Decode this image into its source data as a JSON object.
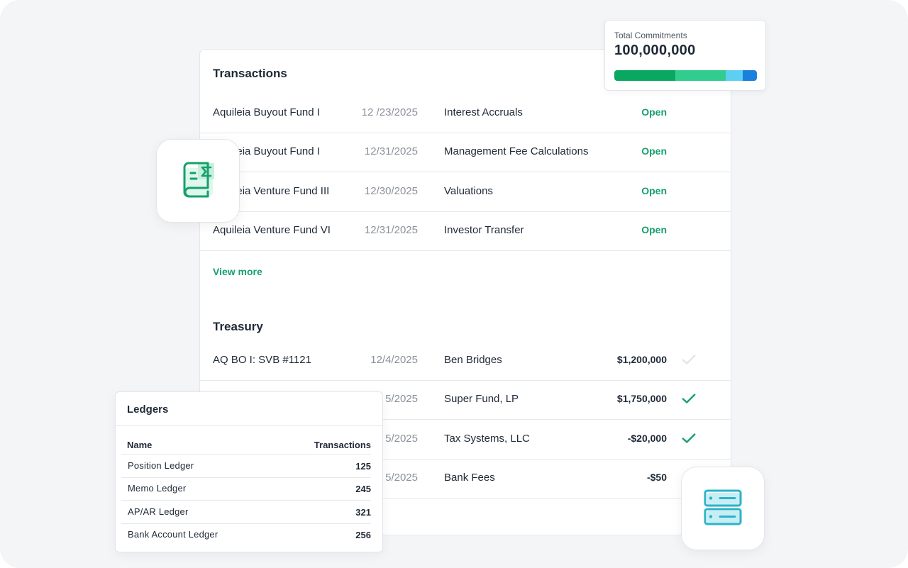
{
  "transactions": {
    "title": "Transactions",
    "rows": [
      {
        "fund": "Aquileia Buyout Fund I",
        "date": "12 /23/2025",
        "task": "Interest Accruals",
        "status": "Open"
      },
      {
        "fund": "Aquileia Buyout Fund I",
        "date": "12/31/2025",
        "task": "Management Fee Calculations",
        "status": "Open"
      },
      {
        "fund": "Aquileia Venture Fund III",
        "date": "12/30/2025",
        "task": "Valuations",
        "status": "Open"
      },
      {
        "fund": "Aquileia Venture Fund VI",
        "date": "12/31/2025",
        "task": "Investor Transfer",
        "status": "Open"
      }
    ],
    "view_more": "View more"
  },
  "treasury": {
    "title": "Treasury",
    "rows": [
      {
        "account": "AQ BO I: SVB #1121",
        "date": "12/4/2025",
        "party": "Ben Bridges",
        "amount": "$1,200,000",
        "reconciled": false
      },
      {
        "account": "",
        "date": "5/2025",
        "party": "Super Fund, LP",
        "amount": "$1,750,000",
        "reconciled": true
      },
      {
        "account": "",
        "date": "5/2025",
        "party": "Tax Systems, LLC",
        "amount": "-$20,000",
        "reconciled": true
      },
      {
        "account": "",
        "date": "5/2025",
        "party": "Bank Fees",
        "amount": "-$50",
        "reconciled": true
      }
    ]
  },
  "commitments": {
    "label": "Total Commitments",
    "value": "100,000,000",
    "segments": [
      {
        "fraction": 0.43,
        "color": "#0aa760"
      },
      {
        "fraction": 0.35,
        "color": "#33cc8f"
      },
      {
        "fraction": 0.12,
        "color": "#5ccff2"
      },
      {
        "fraction": 0.1,
        "color": "#1a80dc"
      }
    ]
  },
  "ledgers": {
    "title": "Ledgers",
    "col_name": "Name",
    "col_transactions": "Transactions",
    "rows": [
      {
        "name": "Position Ledger",
        "count": "125"
      },
      {
        "name": "Memo Ledger",
        "count": "245"
      },
      {
        "name": "AP/AR Ledger",
        "count": "321"
      },
      {
        "name": "Bank Account Ledger",
        "count": "256"
      }
    ]
  },
  "icons": {
    "ledger_book": "ledger-book-icon",
    "server": "server-icon",
    "check": "check-icon"
  },
  "colors": {
    "accent_green": "#16a06b",
    "check_inactive": "#e5e7eb",
    "server_teal": "#2bb3c9"
  }
}
